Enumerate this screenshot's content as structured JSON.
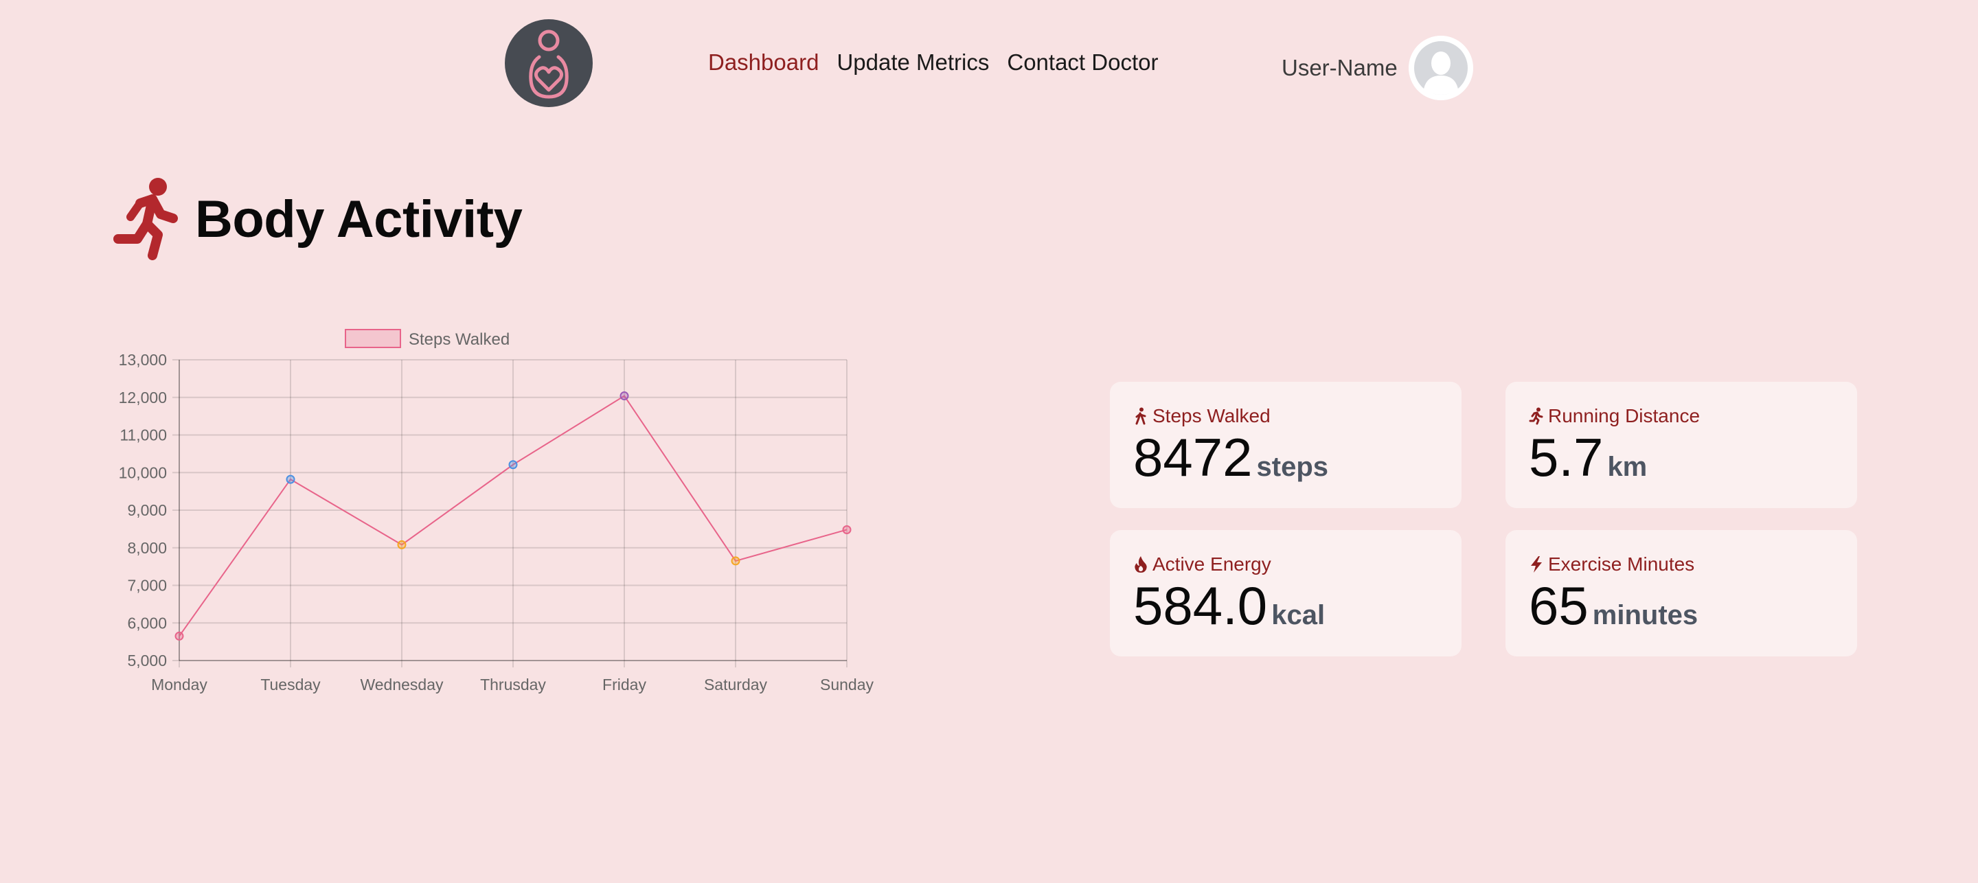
{
  "header": {
    "logo_icon": "mother-heart-logo-icon",
    "nav": [
      {
        "label": "Dashboard",
        "active": true
      },
      {
        "label": "Update Metrics",
        "active": false
      },
      {
        "label": "Contact Doctor",
        "active": false
      }
    ],
    "user_name": "User-Name",
    "avatar_icon": "user-avatar-icon"
  },
  "page": {
    "title": "Body Activity",
    "title_icon": "running-person-icon"
  },
  "stats": [
    {
      "label": "Steps Walked",
      "icon": "walking-icon",
      "value": "8472",
      "unit": "steps"
    },
    {
      "label": "Running Distance",
      "icon": "running-icon",
      "value": "5.7",
      "unit": "km"
    },
    {
      "label": "Active Energy",
      "icon": "flame-icon",
      "value": "584.0",
      "unit": "kcal"
    },
    {
      "label": "Exercise Minutes",
      "icon": "bolt-icon",
      "value": "65",
      "unit": "minutes"
    }
  ],
  "colors": {
    "background": "#f8e2e3",
    "accent": "#8e1f1f",
    "line": "#e8648a"
  },
  "chart_data": {
    "type": "line",
    "categories": [
      "Monday",
      "Tuesday",
      "Wednesday",
      "Thrusday",
      "Friday",
      "Saturday",
      "Sunday"
    ],
    "series": [
      {
        "name": "Steps Walked",
        "values": [
          5650,
          9820,
          8080,
          10210,
          12040,
          7650,
          8480
        ]
      }
    ],
    "point_colors": [
      "#e8648a",
      "#4a90e2",
      "#f5a623",
      "#4a90e2",
      "#9b59b6",
      "#f5a623",
      "#e8648a"
    ],
    "y_ticks": [
      "5,000",
      "6,000",
      "7,000",
      "8,000",
      "9,000",
      "10,000",
      "11,000",
      "12,000",
      "13,000"
    ],
    "ylim": [
      5000,
      13000
    ],
    "grid": true,
    "legend_position": "top"
  }
}
